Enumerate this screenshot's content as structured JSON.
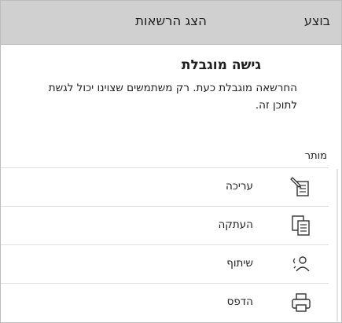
{
  "header": {
    "title": "הצג הרשאות",
    "done_label": "בוצע"
  },
  "dialog": {
    "title": "גישה מוגבלת",
    "message": "החרשאה מוגבלת כעת. רק משתמשים שצוינו יכול לגשת לתוכן זה."
  },
  "permissions": {
    "section_label": "מותר",
    "items": [
      {
        "label": "עריכה",
        "icon": "edit-icon"
      },
      {
        "label": "העתקה",
        "icon": "copy-icon"
      },
      {
        "label": "שיתוף",
        "icon": "share-icon"
      },
      {
        "label": "הדפס",
        "icon": "print-icon"
      }
    ]
  },
  "colors": {
    "header_bg": "#d0d0d0",
    "divider": "#dedede",
    "text": "#1f1f1f"
  }
}
